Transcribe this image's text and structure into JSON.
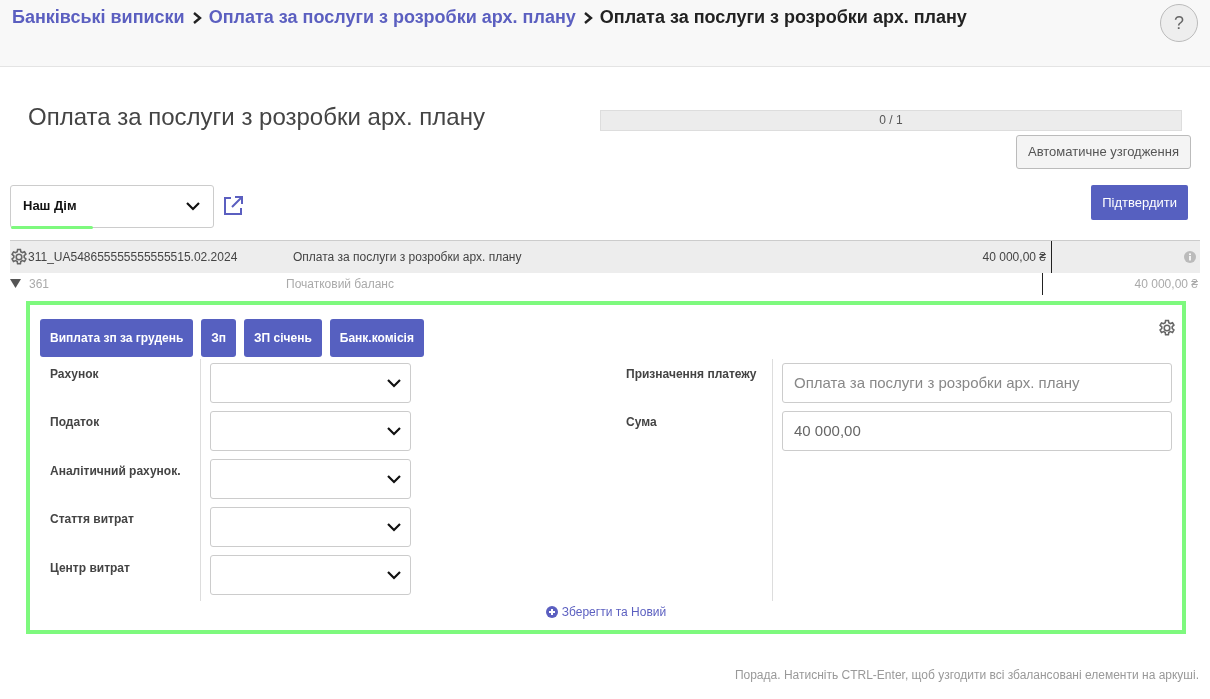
{
  "breadcrumb": [
    {
      "label": "Банківські виписки",
      "link": true
    },
    {
      "label": "Оплата за послуги з розробки арх. плану",
      "link": true
    },
    {
      "label": "Оплата за послуги з розробки арх. плану",
      "link": false
    }
  ],
  "help_button": "?",
  "title": "Оплата за послуги з розробки арх. плану",
  "progress": {
    "level": 0,
    "reading": "0 / 1"
  },
  "auto_reconcile_button": "Автоматичне узгодження",
  "journal_select": {
    "value": "Наш Дім"
  },
  "confirm_button": "Підтвердити",
  "statement_line": {
    "reference": "311_UA548655555555555515.02.2024",
    "label": "Оплата за послуги з розробки арх. плану",
    "amount": "40 000,00 ₴"
  },
  "balance_line": {
    "account": "361",
    "label": "Початковий баланс",
    "amount": "40 000,00 ₴"
  },
  "model_buttons": [
    "Виплата зп за грудень",
    "Зп",
    "ЗП січень",
    "Банк.комісія"
  ],
  "left_fields": [
    {
      "label": "Рахунок"
    },
    {
      "label": "Податок"
    },
    {
      "label": "Аналітичний рахунок."
    },
    {
      "label": "Стаття витрат"
    },
    {
      "label": "Центр витрат"
    }
  ],
  "right_fields": [
    {
      "label": "Призначення платежу",
      "placeholder": "Оплата за послуги з розробки арх. плану"
    },
    {
      "label": "Сума",
      "value": "40 000,00"
    }
  ],
  "save_new_link": "Зберегти та Новий",
  "tip": "Порада. Натисніть CTRL-Enter, щоб узгодити всі збалансовані елементи на аркуші."
}
